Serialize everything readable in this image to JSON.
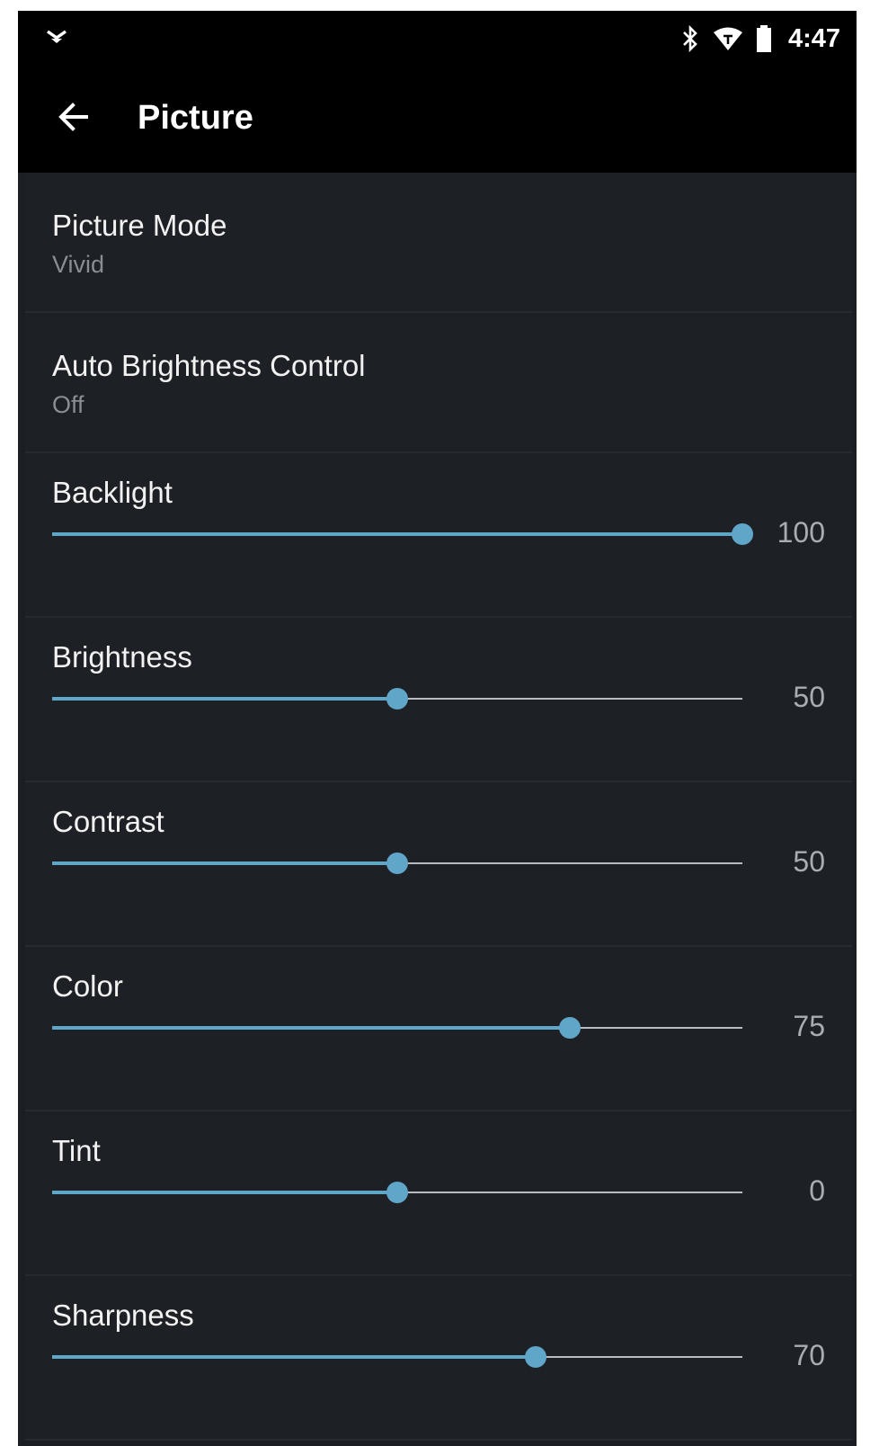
{
  "status_bar": {
    "time": "4:47",
    "icons": [
      "notification-chevron-icon",
      "bluetooth-icon",
      "wifi-icon",
      "battery-icon"
    ]
  },
  "app_bar": {
    "title": "Picture",
    "back_icon": "arrow-left-icon"
  },
  "colors": {
    "accent": "#5fa6c9",
    "background": "#1b1e22",
    "bar": "#000000"
  },
  "settings": {
    "picture_mode": {
      "label": "Picture Mode",
      "value": "Vivid"
    },
    "auto_brightness": {
      "label": "Auto Brightness Control",
      "value": "Off"
    }
  },
  "sliders": [
    {
      "key": "backlight",
      "label": "Backlight",
      "value": "100",
      "level": 1.0
    },
    {
      "key": "brightness",
      "label": "Brightness",
      "value": "50",
      "level": 0.5
    },
    {
      "key": "contrast",
      "label": "Contrast",
      "value": "50",
      "level": 0.5
    },
    {
      "key": "color",
      "label": "Color",
      "value": "75",
      "level": 0.75
    },
    {
      "key": "tint",
      "label": "Tint",
      "value": "0",
      "level": 0.5
    },
    {
      "key": "sharpness",
      "label": "Sharpness",
      "value": "70",
      "level": 0.7
    }
  ]
}
